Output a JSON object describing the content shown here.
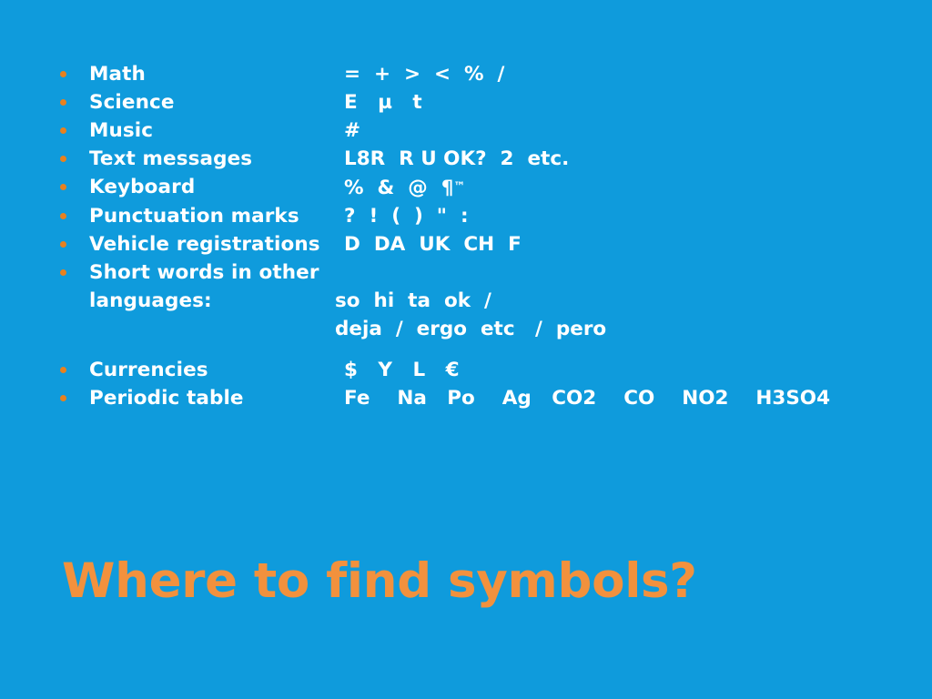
{
  "slide": {
    "title": "Where to find symbols?",
    "background_color": "#0f9bdc",
    "title_color": "#f2913d",
    "text_color": "#ffffff",
    "bullet_color": "#e8811e"
  },
  "rows": [
    {
      "label": "Math",
      "value": "=  +  >  <  %  /"
    },
    {
      "label": "Science",
      "value": "E   µ   t"
    },
    {
      "label": "Music",
      "value": "#"
    },
    {
      "label": "Text messages",
      "value": "L8R  R U OK?  2  etc."
    },
    {
      "label": "Keyboard",
      "value": "%  &  @  ¶",
      "superscript": "™"
    },
    {
      "label": "Punctuation marks",
      "value": "?  !  (  )  \"  :"
    },
    {
      "label": "Vehicle registrations",
      "value": "D  DA  UK  CH  F"
    },
    {
      "label": "Short words in other languages:",
      "value": "so  hi  ta  ok  /",
      "value_line2": "deja  /  ergo  etc   /  pero"
    },
    {
      "label": "Currencies",
      "value": "$   Y   L   €"
    },
    {
      "label": "Periodic table",
      "value": "Fe    Na   Po    Ag   CO2    CO    NO2    H3SO4"
    }
  ]
}
